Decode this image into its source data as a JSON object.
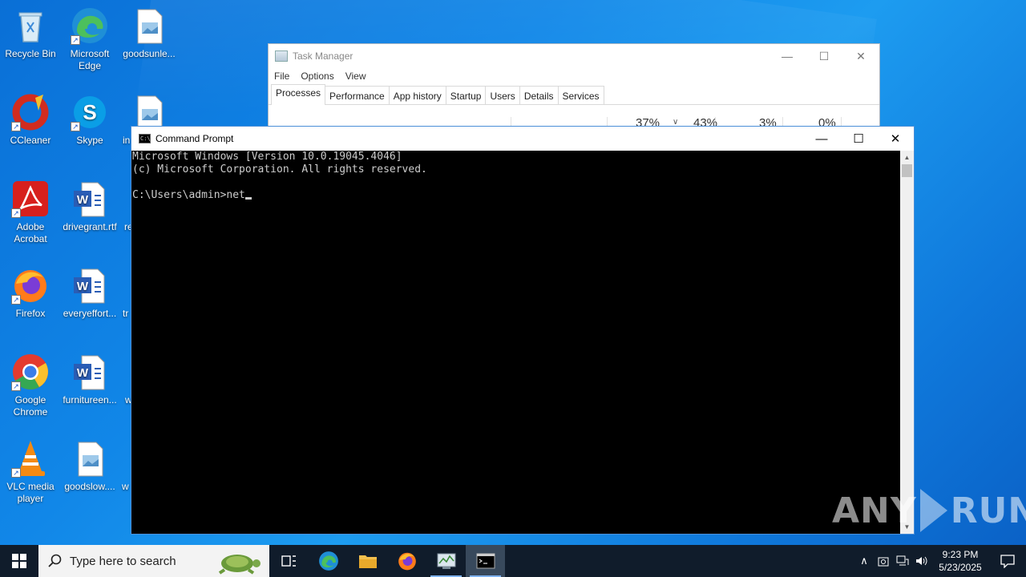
{
  "desktop": {
    "icons": [
      {
        "label": "Recycle Bin"
      },
      {
        "label": "Microsoft Edge"
      },
      {
        "label": "goodsunle..."
      },
      {
        "label": "CCleaner"
      },
      {
        "label": "Skype"
      },
      {
        "label": "in"
      },
      {
        "label": "Adobe Acrobat"
      },
      {
        "label": "drivegrant.rtf"
      },
      {
        "label": "re"
      },
      {
        "label": "Firefox"
      },
      {
        "label": "everyeffort..."
      },
      {
        "label": "tr"
      },
      {
        "label": "Google Chrome"
      },
      {
        "label": "furnitureen..."
      },
      {
        "label": "w"
      },
      {
        "label": "VLC media player"
      },
      {
        "label": "goodslow...."
      },
      {
        "label": "w"
      }
    ]
  },
  "task_manager": {
    "title": "Task Manager",
    "menu": [
      "File",
      "Options",
      "View"
    ],
    "tabs": [
      "Processes",
      "Performance",
      "App history",
      "Startup",
      "Users",
      "Details",
      "Services"
    ],
    "active_tab": "Processes",
    "stats": {
      "cpu": "37%",
      "memory": "43%",
      "disk": "3%",
      "network": "0%"
    }
  },
  "cmd": {
    "title": "Command Prompt",
    "lines": [
      "Microsoft Windows [Version 10.0.19045.4046]",
      "(c) Microsoft Corporation. All rights reserved.",
      "",
      "C:\\Users\\admin>net"
    ]
  },
  "watermark": {
    "left": "ANY",
    "right": "RUN"
  },
  "taskbar": {
    "search_placeholder": "Type here to search",
    "apps": [
      "task-view",
      "edge",
      "file-explorer",
      "firefox",
      "task-manager",
      "command-prompt"
    ],
    "active_app": "command-prompt",
    "clock": {
      "time": "9:23 PM",
      "date": "5/23/2025"
    }
  },
  "colors": {
    "taskbar": "#101c2b",
    "console_bg": "#000000",
    "console_fg": "#cccccc",
    "desktop": "#1187e8"
  }
}
